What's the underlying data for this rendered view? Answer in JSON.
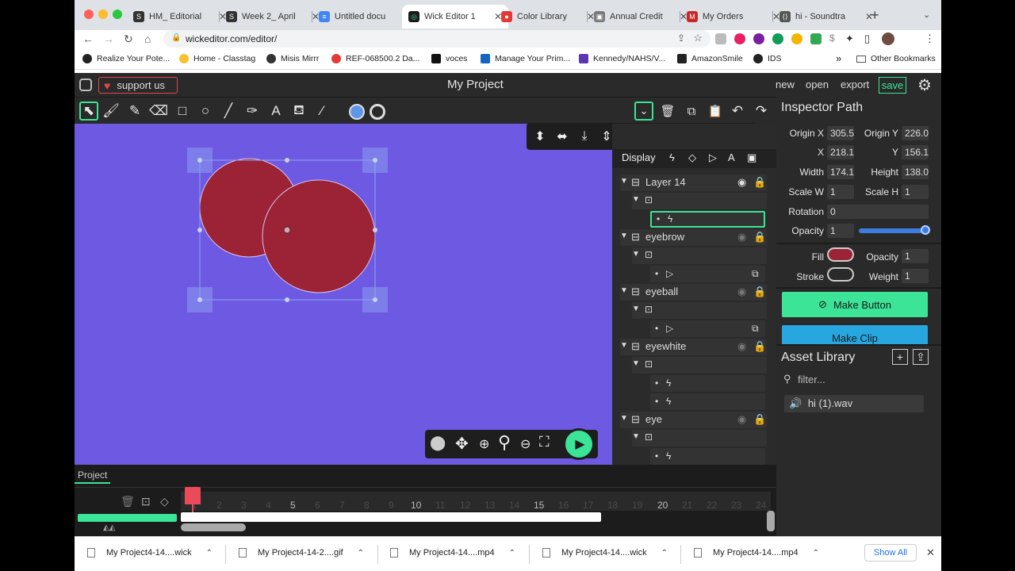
{
  "browser": {
    "tabs": [
      {
        "label": "HM_ Editorial",
        "color": "#333333",
        "glyph": "S"
      },
      {
        "label": "Week 2_ April",
        "color": "#333333",
        "glyph": "S"
      },
      {
        "label": "Untitled docu",
        "color": "#4285f4",
        "glyph": "≡"
      },
      {
        "label": "Wick Editor 1",
        "color": "#3ce497",
        "glyph": "◎"
      },
      {
        "label": "Color Library",
        "color": "#e53935",
        "glyph": "●"
      },
      {
        "label": "Annual Credit",
        "color": "#7a7a7a",
        "glyph": "▣"
      },
      {
        "label": "My Orders",
        "color": "#c62828",
        "glyph": "M"
      },
      {
        "label": "hi - Soundtra",
        "color": "#555555",
        "glyph": "⟨⟩"
      }
    ],
    "new_tab": "+",
    "url": "wickeditor.com/editor/",
    "bookmarks": [
      "Realize Your Pote...",
      "Home - Classtag",
      "Misis Mirrr",
      "REF-068500.2 Da...",
      "voces",
      "Manage Your Prim...",
      "Kennedy/NAHS/V...",
      "AmazonSmile",
      "IDS"
    ],
    "more_bookmarks": "»",
    "other_bookmarks": "Other Bookmarks"
  },
  "app": {
    "project_title": "My Project",
    "support_label": "support us",
    "menu": {
      "new": "new",
      "open": "open",
      "export": "export",
      "save": "save"
    }
  },
  "timeline_panel": {
    "display_label": "Display",
    "layers": [
      {
        "name": "Layer 14",
        "top": 0
      },
      {
        "name": "eyebrow",
        "top": 0
      },
      {
        "name": "eyeball",
        "top": 0
      },
      {
        "name": "eyewhite",
        "top": 0
      },
      {
        "name": "eye",
        "top": 0
      }
    ]
  },
  "inspector": {
    "title": "Inspector",
    "subtitle": "Path",
    "origin_x_label": "Origin X",
    "origin_x": "305.5",
    "origin_y_label": "Origin Y",
    "origin_y": "226.0",
    "x_label": "X",
    "x": "218.1",
    "y_label": "Y",
    "y": "156.1",
    "width_label": "Width",
    "width": "174.1",
    "height_label": "Height",
    "height": "138.0",
    "scale_w_label": "Scale W",
    "scale_w": "1",
    "scale_h_label": "Scale H",
    "scale_h": "1",
    "rotation_label": "Rotation",
    "rotation": "0",
    "opacity_label": "Opacity",
    "opacity": "1",
    "fill_label": "Fill",
    "fill_color": "#9b2335",
    "fill_opacity_label": "Opacity",
    "fill_opacity": "1",
    "stroke_label": "Stroke",
    "weight_label": "Weight",
    "weight": "1",
    "make_button": "Make Button",
    "make_clip": "Make Clip"
  },
  "assets": {
    "title": "Asset Library",
    "filter_placeholder": "filter...",
    "items": [
      "hi (1).wav"
    ]
  },
  "bottom": {
    "project_tab": "Project",
    "frame_numbers": [
      "1",
      "2",
      "3",
      "4",
      "5",
      "6",
      "7",
      "8",
      "9",
      "10",
      "11",
      "12",
      "13",
      "14",
      "15",
      "16",
      "17",
      "18",
      "19",
      "20",
      "21",
      "22",
      "23",
      "24"
    ]
  },
  "downloads": {
    "items": [
      "My Project4-14....wick",
      "My Project4-14-2....gif",
      "My Project4-14....mp4",
      "My Project4-14....wick",
      "My Project4-14....mp4"
    ],
    "show_all": "Show All"
  },
  "colors": {
    "canvas": "#6e59e2",
    "accent": "#3ce497",
    "shape": "#9b2335"
  }
}
